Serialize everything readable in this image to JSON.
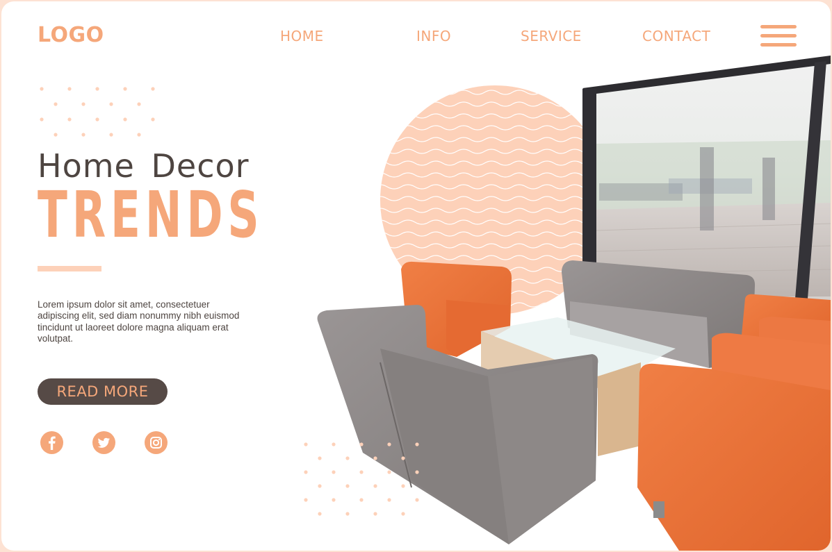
{
  "header": {
    "logo": "LOGO",
    "nav": [
      "HOME",
      "INFO",
      "SERVICE",
      "CONTACT"
    ],
    "menu_icon": "hamburger-menu-icon"
  },
  "hero": {
    "title_line1": "Home Decor",
    "title_line2": "TRENDS",
    "body": "Lorem ipsum dolor sit amet, consectetuer adipiscing elit, sed diam nonummy nibh euismod tincidunt ut laoreet dolore magna aliquam erat volutpat.",
    "button_label": "READ MORE"
  },
  "social": [
    {
      "name": "facebook-icon"
    },
    {
      "name": "twitter-icon"
    },
    {
      "name": "instagram-icon"
    }
  ],
  "colors": {
    "accent": "#f5a77a",
    "accent_light": "#fdd1b9",
    "dark": "#564a46",
    "text": "#4e4541",
    "frame": "#fde2d3"
  },
  "image": {
    "description_icon": "lounge-furniture-photo"
  }
}
